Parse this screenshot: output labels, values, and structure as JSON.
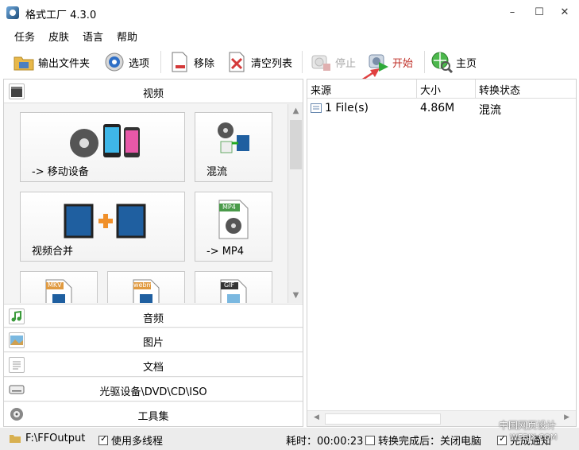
{
  "window": {
    "title": "格式工厂 4.3.0",
    "min": "–",
    "max": "☐",
    "close": "✕"
  },
  "menu": [
    "任务",
    "皮肤",
    "语言",
    "帮助"
  ],
  "toolbar": {
    "output_folder": "输出文件夹",
    "options": "选项",
    "remove": "移除",
    "clear_list": "清空列表",
    "stop": "停止",
    "start": "开始",
    "home": "主页"
  },
  "left": {
    "categories": {
      "video": "视频",
      "audio": "音频",
      "image": "图片",
      "document": "文档",
      "disc": "光驱设备\\DVD\\CD\\ISO",
      "tools": "工具集"
    },
    "tiles": {
      "mobile": "-> 移动设备",
      "mux": "混流",
      "merge": "视频合并",
      "mp4": "-> MP4",
      "mp4_badge": "MP4",
      "mkv_badge": "MKV",
      "webm_badge": "webm",
      "gif_badge": "GIF"
    }
  },
  "table": {
    "headers": [
      "来源",
      "大小",
      "转换状态"
    ],
    "rows": [
      {
        "source": "1 File(s)",
        "size": "4.86M",
        "status": "混流"
      }
    ]
  },
  "status": {
    "output_path": "F:\\FFOutput",
    "multithread_label": "使用多线程",
    "multithread_checked": true,
    "elapsed": "耗时：00:00:23",
    "after_label": "转换完成后：关闭电脑",
    "after_checked": false,
    "notify_label": "完成通知"
  },
  "watermark": [
    "中国网页设计",
    "WEBJX.COM"
  ],
  "colors": {
    "accent_red": "#c03028",
    "arrow": "#e04040"
  }
}
